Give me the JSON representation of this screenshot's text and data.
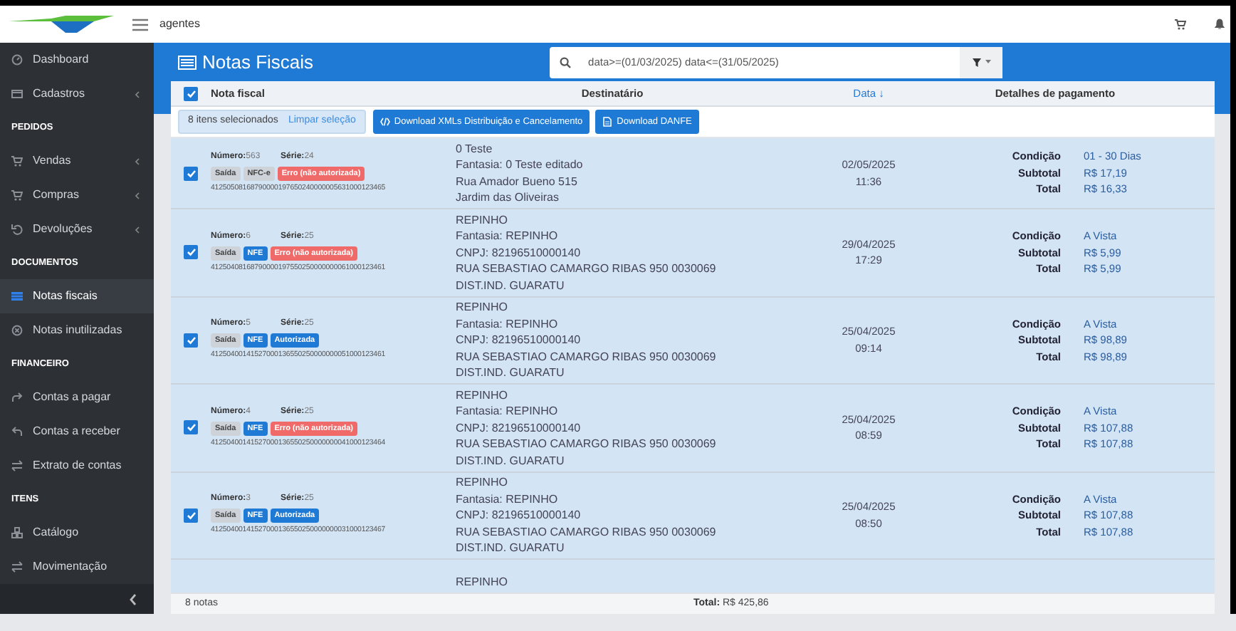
{
  "topbar": {
    "account": "agentes"
  },
  "sidebar": {
    "items": [
      {
        "kind": "item",
        "label": "Dashboard",
        "selected": false,
        "submenu": false
      },
      {
        "kind": "item",
        "label": "Cadastros",
        "selected": false,
        "submenu": true
      },
      {
        "kind": "section",
        "label": "PEDIDOS"
      },
      {
        "kind": "item",
        "label": "Vendas",
        "selected": false,
        "submenu": true
      },
      {
        "kind": "item",
        "label": "Compras",
        "selected": false,
        "submenu": true
      },
      {
        "kind": "item",
        "label": "Devoluções",
        "selected": false,
        "submenu": true
      },
      {
        "kind": "section",
        "label": "DOCUMENTOS"
      },
      {
        "kind": "item",
        "label": "Notas fiscais",
        "selected": true,
        "submenu": false
      },
      {
        "kind": "item",
        "label": "Notas inutilizadas",
        "selected": false,
        "submenu": false
      },
      {
        "kind": "section",
        "label": "FINANCEIRO"
      },
      {
        "kind": "item",
        "label": "Contas a pagar",
        "selected": false,
        "submenu": false
      },
      {
        "kind": "item",
        "label": "Contas a receber",
        "selected": false,
        "submenu": false
      },
      {
        "kind": "item",
        "label": "Extrato de contas",
        "selected": false,
        "submenu": false
      },
      {
        "kind": "section",
        "label": "ITENS"
      },
      {
        "kind": "item",
        "label": "Catálogo",
        "selected": false,
        "submenu": false
      },
      {
        "kind": "item",
        "label": "Movimentação",
        "selected": false,
        "submenu": false
      }
    ]
  },
  "page": {
    "title": "Notas Fiscais",
    "search": {
      "value": "data>=(01/03/2025) data<=(31/05/2025)"
    }
  },
  "table": {
    "select_all": {
      "checked": true
    },
    "columns": [
      "Nota fiscal",
      "Destinatário",
      "Data ↓",
      "Detalhes de pagamento"
    ],
    "selection": {
      "count": "8 itens selecionados",
      "clear": "Limpar seleção"
    },
    "actions": [
      {
        "label": "Download XMLs Distribuição e Cancelamento"
      },
      {
        "label": "Download DANFE"
      }
    ],
    "rows": [
      {
        "selected": true,
        "numero_label": "Número:",
        "numero": "563",
        "serie_label": "Série:",
        "serie": "24",
        "badges": [
          {
            "kind": "neutral",
            "label": "Saída"
          },
          {
            "kind": "neutral",
            "label": "NFC-e"
          },
          {
            "kind": "error",
            "label": "Erro (não autorizada)"
          }
        ],
        "chave": "41250508168790000197650240000005631000123465",
        "destinatario": [
          "0 Teste",
          "Fantasia: 0 Teste editado",
          "Rua Amador Bueno 515",
          "Jardim das Oliveiras"
        ],
        "data": "02/05/2025",
        "hora": "11:36",
        "pagamento": [
          {
            "label": "Condição",
            "value": "01 - 30 Dias"
          },
          {
            "label": "Subtotal",
            "value": "R$ 17,19"
          },
          {
            "label": "Total",
            "value": "R$ 16,33"
          }
        ]
      },
      {
        "selected": true,
        "numero_label": "Número:",
        "numero": "6",
        "serie_label": "Série:",
        "serie": "25",
        "badges": [
          {
            "kind": "neutral",
            "label": "Saída"
          },
          {
            "kind": "info",
            "label": "NFE"
          },
          {
            "kind": "error",
            "label": "Erro (não autorizada)"
          }
        ],
        "chave": "41250408168790000197550250000000061000123461",
        "destinatario": [
          "REPINHO",
          "Fantasia: REPINHO",
          "CNPJ: 82196510000140",
          "RUA SEBASTIAO CAMARGO RIBAS 950 0030069",
          "DIST.IND. GUARATU"
        ],
        "data": "29/04/2025",
        "hora": "17:29",
        "pagamento": [
          {
            "label": "Condição",
            "value": "A Vista"
          },
          {
            "label": "Subtotal",
            "value": "R$ 5,99"
          },
          {
            "label": "Total",
            "value": "R$ 5,99"
          }
        ]
      },
      {
        "selected": true,
        "numero_label": "Número:",
        "numero": "5",
        "serie_label": "Série:",
        "serie": "25",
        "badges": [
          {
            "kind": "neutral",
            "label": "Saída"
          },
          {
            "kind": "info",
            "label": "NFE"
          },
          {
            "kind": "info",
            "label": "Autorizada"
          }
        ],
        "chave": "41250400141527000136550250000000051000123461",
        "destinatario": [
          "REPINHO",
          "Fantasia: REPINHO",
          "CNPJ: 82196510000140",
          "RUA SEBASTIAO CAMARGO RIBAS 950 0030069",
          "DIST.IND. GUARATU"
        ],
        "data": "25/04/2025",
        "hora": "09:14",
        "pagamento": [
          {
            "label": "Condição",
            "value": "A Vista"
          },
          {
            "label": "Subtotal",
            "value": "R$ 98,89"
          },
          {
            "label": "Total",
            "value": "R$ 98,89"
          }
        ]
      },
      {
        "selected": true,
        "numero_label": "Número:",
        "numero": "4",
        "serie_label": "Série:",
        "serie": "25",
        "badges": [
          {
            "kind": "neutral",
            "label": "Saída"
          },
          {
            "kind": "info",
            "label": "NFE"
          },
          {
            "kind": "error",
            "label": "Erro (não autorizada)"
          }
        ],
        "chave": "41250400141527000136550250000000041000123464",
        "destinatario": [
          "REPINHO",
          "Fantasia: REPINHO",
          "CNPJ: 82196510000140",
          "RUA SEBASTIAO CAMARGO RIBAS 950 0030069",
          "DIST.IND. GUARATU"
        ],
        "data": "25/04/2025",
        "hora": "08:59",
        "pagamento": [
          {
            "label": "Condição",
            "value": "A Vista"
          },
          {
            "label": "Subtotal",
            "value": "R$ 107,88"
          },
          {
            "label": "Total",
            "value": "R$ 107,88"
          }
        ]
      },
      {
        "selected": true,
        "numero_label": "Número:",
        "numero": "3",
        "serie_label": "Série:",
        "serie": "25",
        "badges": [
          {
            "kind": "neutral",
            "label": "Saída"
          },
          {
            "kind": "info",
            "label": "NFE"
          },
          {
            "kind": "info",
            "label": "Autorizada"
          }
        ],
        "chave": "41250400141527000136550250000000031000123467",
        "destinatario": [
          "REPINHO",
          "Fantasia: REPINHO",
          "CNPJ: 82196510000140",
          "RUA SEBASTIAO CAMARGO RIBAS 950 0030069",
          "DIST.IND. GUARATU"
        ],
        "data": "25/04/2025",
        "hora": "08:50",
        "pagamento": [
          {
            "label": "Condição",
            "value": "A Vista"
          },
          {
            "label": "Subtotal",
            "value": "R$ 107,88"
          },
          {
            "label": "Total",
            "value": "R$ 107,88"
          }
        ]
      }
    ],
    "partial_row": {
      "destinatario": "REPINHO"
    },
    "footer": {
      "count": "8 notas",
      "total_label": "Total:",
      "total": "R$ 425,86"
    }
  }
}
